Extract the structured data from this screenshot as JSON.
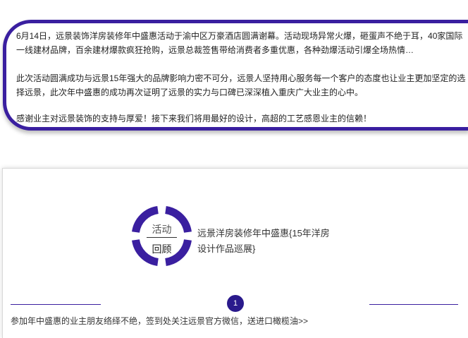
{
  "article": {
    "paragraph1": "6月14日，远景装饰洋房装修年中盛惠活动于渝中区万豪酒店圆满谢幕。活动现场异常火爆，砸蛋声不绝于耳，40家国际一线建材品牌，百余建材爆款疯狂抢购，远景总裁签售带给消费者多重优惠，各种劲爆活动引爆全场热情…",
    "paragraph2": "此次活动圆满成功与远景15年强大的品牌影响力密不可分，远景人坚持用心服务每一个客户的态度也让业主更加坚定的选择远景，此次年中盛惠的成功再次证明了远景的实力与口碑已深深植入重庆广大业主的心中。",
    "paragraph3": "感谢业主对远景装饰的支持与厚爱！接下来我们将用最好的设计，高超的工艺感恩业主的信赖！"
  },
  "review": {
    "badge_top": "活动",
    "badge_bottom": "回顾",
    "caption": "远景洋房装修年中盛惠{15年洋房设计作品巡展}",
    "page_number": "1",
    "footer_text": "参加年中盛惠的业主朋友络绎不绝，签到处关注远景官方微信，送进口橄榄油>>"
  },
  "colors": {
    "accent": "#3a1fa0",
    "accent_dark": "#2a1a8c"
  }
}
